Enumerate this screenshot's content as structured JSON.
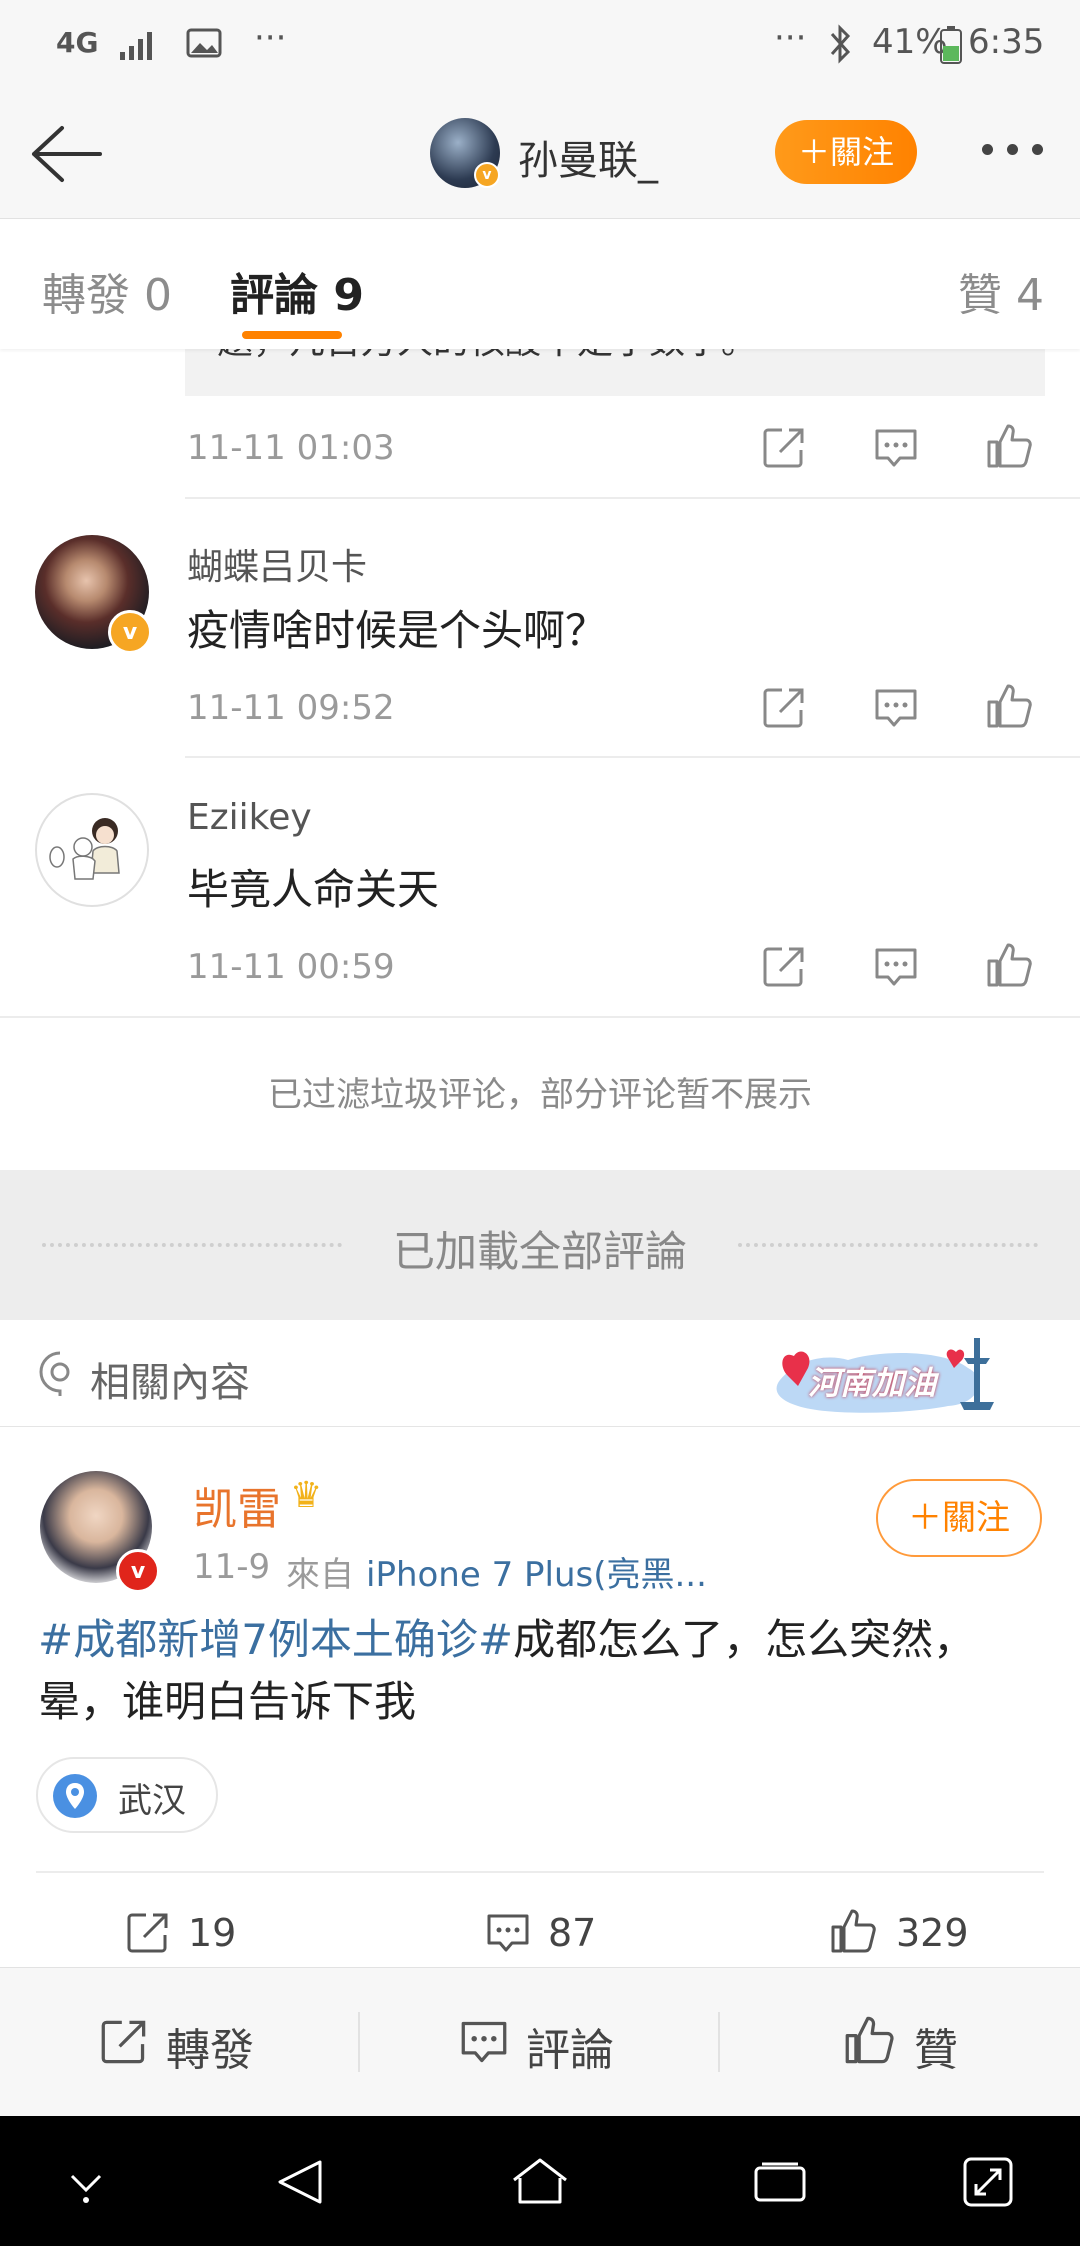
{
  "status_bar": {
    "network": "4G",
    "battery_percent": "41%",
    "time": "6:35"
  },
  "header": {
    "username": "孙曼联_",
    "follow_label": "＋關注"
  },
  "tabs": {
    "repost": "轉發 0",
    "comments": "評論 9",
    "likes": "贊 4"
  },
  "comments": [
    {
      "quote_partial": "题，几百万人的核酸不是小数字。",
      "time": "11-11 01:03"
    },
    {
      "name": "蝴蝶吕贝卡",
      "text": "疫情啥时候是个头啊？",
      "time": "11-11 09:52"
    },
    {
      "name": "Eziikey",
      "text": "毕竟人命关天",
      "time": "11-11 00:59"
    }
  ],
  "filter_note": "已过滤垃圾评论，部分评论暂不展示",
  "all_loaded": "已加載全部評論",
  "related": {
    "title": "相關內容",
    "banner_text": "河南加油"
  },
  "post": {
    "author": "凯雷",
    "follow_label": "＋關注",
    "date": "11-9",
    "source_prefix": "來自",
    "source": "iPhone 7 Plus(亮黑...",
    "hashtag": "#成都新增7例本土确诊#",
    "body": "成都怎么了，怎么突然，晕，谁明白告诉下我",
    "location": "武汉",
    "reposts": "19",
    "comments": "87",
    "likes": "329"
  },
  "bottom_bar": {
    "repost": "轉發",
    "comment": "評論",
    "like": "贊"
  },
  "colors": {
    "accent_orange": "#ff8200",
    "link_blue": "#3b6fa0",
    "verified_gold": "#f6a623",
    "verified_red": "#e0251b"
  }
}
